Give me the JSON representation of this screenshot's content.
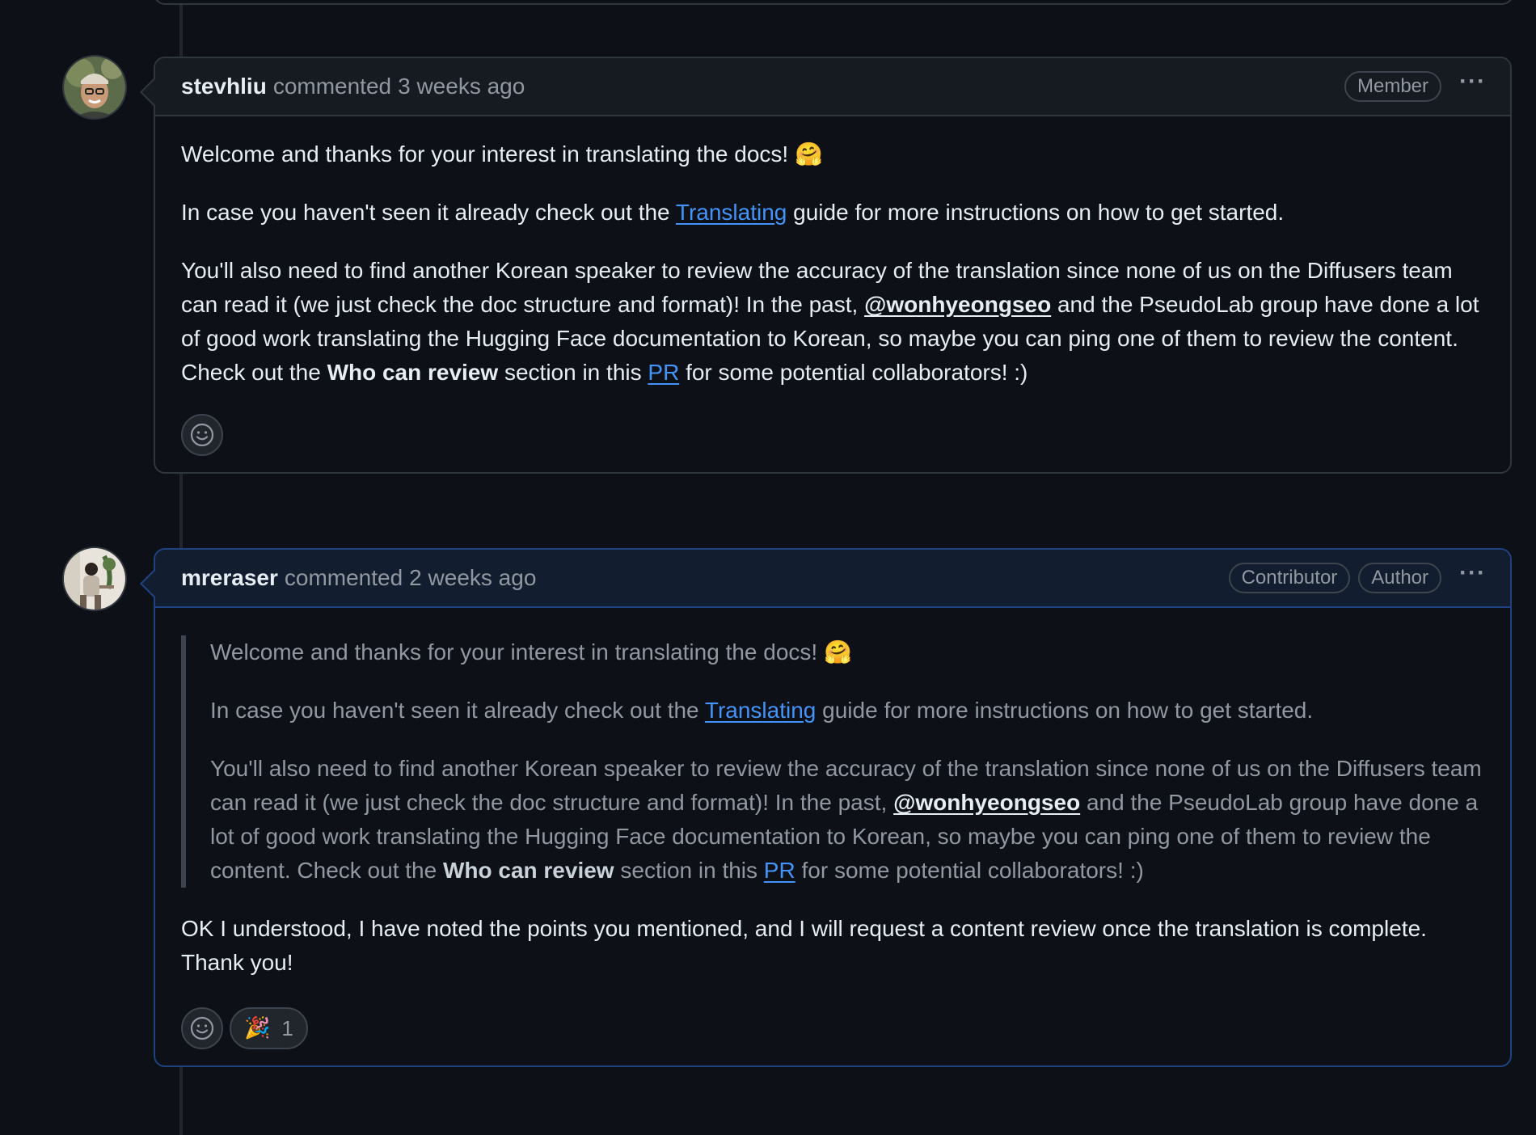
{
  "comments": [
    {
      "author": "stevhliu",
      "action": "commented",
      "time": "3 weeks ago",
      "badges": [
        "Member"
      ],
      "menu_icon": "kebab-horizontal-icon",
      "paragraphs": {
        "p1_text": "Welcome and thanks for your interest in translating the docs! ",
        "p1_emoji": "🤗",
        "p2_pre": "In case you haven't seen it already check out the ",
        "p2_link": "Translating",
        "p2_post": " guide for more instructions on how to get started.",
        "p3_pre": "You'll also need to find another Korean speaker to review the accuracy of the translation since none of us on the Diffusers team can read it (we just check the doc structure and format)! In the past, ",
        "p3_mention": "@wonhyeongseo",
        "p3_mid": " and the PseudoLab group have done a lot of good work translating the Hugging Face documentation to Korean, so maybe you can ping one of them to review the content. Check out the ",
        "p3_bold": "Who can review",
        "p3_mid2": " section in this ",
        "p3_link": "PR",
        "p3_post": " for some potential collaborators! :)"
      },
      "reaction_icon": "smiley-icon"
    },
    {
      "author": "mreraser",
      "action": "commented",
      "time": "2 weeks ago",
      "badges": [
        "Contributor",
        "Author"
      ],
      "menu_icon": "kebab-horizontal-icon",
      "quote": {
        "p1_text": "Welcome and thanks for your interest in translating the docs! ",
        "p1_emoji": "🤗",
        "p2_pre": "In case you haven't seen it already check out the ",
        "p2_link": "Translating",
        "p2_post": " guide for more instructions on how to get started.",
        "p3_pre": "You'll also need to find another Korean speaker to review the accuracy of the translation since none of us on the Diffusers team can read it (we just check the doc structure and format)! In the past, ",
        "p3_mention": "@wonhyeongseo",
        "p3_mid": " and the PseudoLab group have done a lot of good work translating the Hugging Face documentation to Korean, so maybe you can ping one of them to review the content. Check out the ",
        "p3_bold": "Who can review",
        "p3_mid2": " section in this ",
        "p3_link": "PR",
        "p3_post": " for some potential collaborators! :)"
      },
      "reply": "OK I understood, I have noted the points you mentioned, and I will request a content review once the translation is complete. Thank you!",
      "reaction_icon": "smiley-icon",
      "reactions": [
        {
          "emoji": "🎉",
          "count": "1"
        }
      ]
    }
  ],
  "colors": {
    "background": "#0d1117",
    "header_bg": "#161b22",
    "author_header_bg": "#121d2f",
    "author_border": "#1f4280",
    "link": "#4493f8",
    "muted": "#9198a1"
  }
}
